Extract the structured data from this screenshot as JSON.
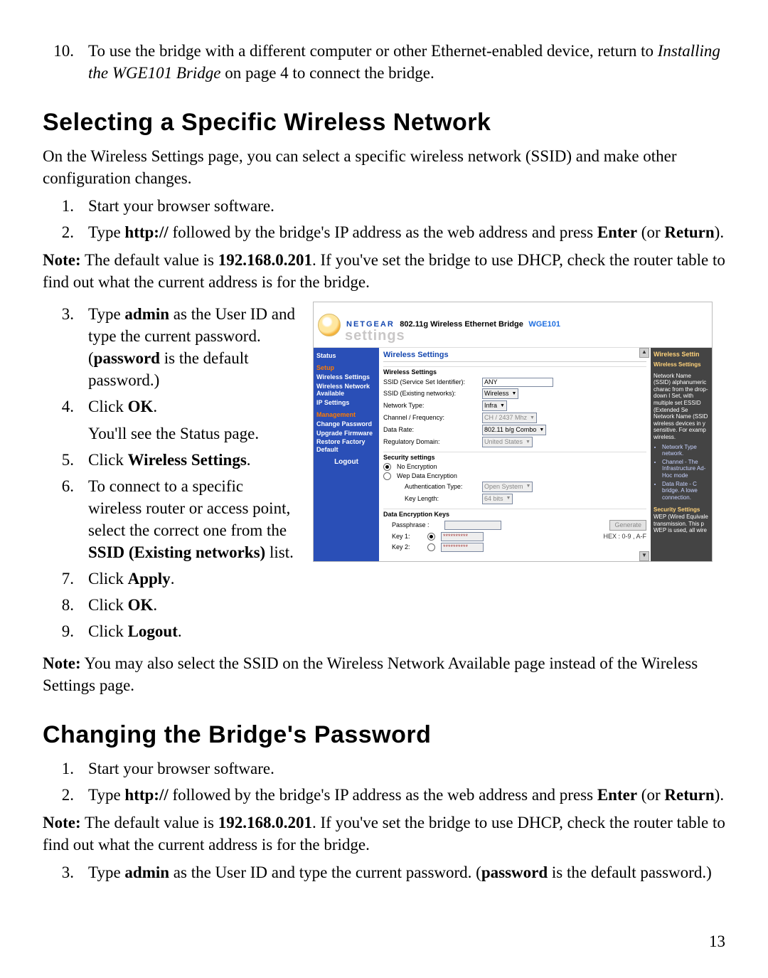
{
  "intro_step10": {
    "pre": "To use the bridge with a different computer or other Ethernet-enabled device, return to ",
    "linktext": "Installing the WGE101 Bridge",
    "post": " on page 4 to connect the bridge."
  },
  "sec1": {
    "title": "Selecting a Specific Wireless Network",
    "intro": "On the Wireless Settings page, you can select a specific wireless network (SSID) and make other configuration changes.",
    "s1": "Start your browser software.",
    "s2_pre": "Type ",
    "s2_http": "http://",
    "s2_mid": " followed by the bridge's IP address as the web address and press ",
    "s2_enter": "Enter",
    "s2_or": " (or ",
    "s2_return": "Return",
    "s2_end": ").",
    "note1_pre": "Note:",
    "note1_a": " The default value is ",
    "note1_ip": "192.168.0.201",
    "note1_b": ". If you've set the bridge to use DHCP, check the router table to find out what the current address is for the bridge.",
    "s3_a": "Type ",
    "s3_admin": "admin",
    "s3_b": " as the User ID and type the current password. (",
    "s3_pw": "password",
    "s3_c": " is the default password.)",
    "s4_a": "Click ",
    "s4_ok": "OK",
    "s4_b": ".",
    "s4_after": "You'll see the Status page.",
    "s5_a": "Click ",
    "s5_ws": "Wireless Settings",
    "s5_b": ".",
    "s6_a": "To connect to a specific wireless router or access point, select the correct one from the ",
    "s6_ssid": "SSID (Existing networks)",
    "s6_b": " list.",
    "s7_a": "Click ",
    "s7_apply": "Apply",
    "s7_b": ".",
    "s8_a": "Click ",
    "s8_ok": "OK",
    "s8_b": ".",
    "s9_a": "Click ",
    "s9_logout": "Logout",
    "s9_b": ".",
    "note2_pre": "Note:",
    "note2_body": " You may also select the SSID on the Wireless Network Available page instead of the Wireless Settings page."
  },
  "sec2": {
    "title": "Changing the Bridge's Password",
    "s1": "Start your browser software.",
    "s2_pre": "Type ",
    "s2_http": "http://",
    "s2_mid": " followed by the bridge's IP address as the web address and press ",
    "s2_enter": "Enter",
    "s2_or": " (or ",
    "s2_return": "Return",
    "s2_end": ").",
    "note_pre": "Note:",
    "note_a": " The default value is ",
    "note_ip": "192.168.0.201",
    "note_b": ". If you've set the bridge to use DHCP, check the router table to find out what the current address is for the bridge.",
    "s3_a": "Type ",
    "s3_admin": "admin",
    "s3_b": " as the User ID and type the current password. (",
    "s3_pw": "password",
    "s3_c": " is the default password.)"
  },
  "router": {
    "brand": "NETGEAR",
    "title": "802.11g Wireless Ethernet Bridge",
    "model": "WGE101",
    "settings_word": "settings",
    "sidebar": {
      "status": "Status",
      "setup": "Setup",
      "wireless_settings": "Wireless Settings",
      "wireless_net_avail": "Wireless Network Available",
      "ip_settings": "IP Settings",
      "management": "Management",
      "change_pw": "Change Password",
      "upgrade_fw": "Upgrade Firmware",
      "restore": "Restore Factory Default",
      "logout": "Logout"
    },
    "main": {
      "title": "Wireless Settings",
      "sec_wireless": "Wireless Settings",
      "ssid_label": "SSID (Service Set Identifier):",
      "ssid_value": "ANY",
      "ssid_existing_label": "SSID (Existing networks):",
      "ssid_existing_value": "Wireless",
      "nettype_label": "Network Type:",
      "nettype_value": "Infra",
      "chan_label": "Channel / Frequency:",
      "chan_value": "CH / 2437 Mhz",
      "rate_label": "Data Rate:",
      "rate_value": "802.11 b/g Combo",
      "reg_label": "Regulatory Domain:",
      "reg_value": "United States",
      "sec_security": "Security settings",
      "noenc": "No Encryption",
      "wep": "Wep Data Encryption",
      "auth_label": "Authentication Type:",
      "auth_value": "Open System",
      "keylen_label": "Key Length:",
      "keylen_value": "64 bits",
      "sec_keys": "Data Encryption Keys",
      "pass_label": "Passphrase :",
      "generate": "Generate",
      "key1": "Key 1:",
      "key2": "Key 2:",
      "hex": "HEX : 0-9 , A-F",
      "masked": "**********"
    },
    "help": {
      "title": "Wireless Settin",
      "sub": "Wireless Settings",
      "p1": "Network Name (SSID) alphanumeric charac from the drop-down l Set, with multiple set ESSID (Extended Se Network Name (SSID wireless devices in y sensitive. For examp wireless.",
      "li1": "Network Type network.",
      "li2": "Channel - The Infrastructure Ad-Hoc mode",
      "li3": "Data Rate - C bridge. A lowe connection.",
      "sec2": "Security Settings",
      "p2": "WEP (Wired Equivale transmission. This p WEP is used, all wire"
    }
  },
  "page_number": "13"
}
